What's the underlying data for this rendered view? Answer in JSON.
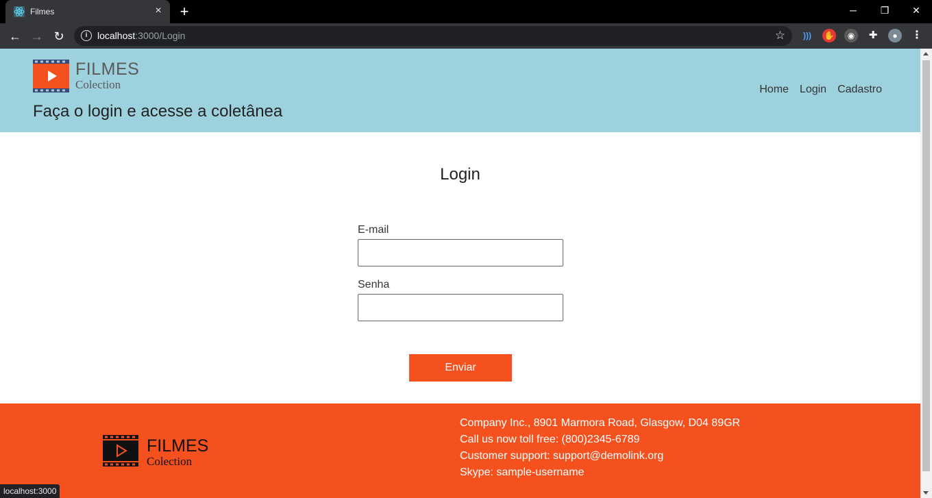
{
  "browser": {
    "tab_title": "Filmes",
    "tab_close": "×",
    "new_tab": "+",
    "url_host": "localhost",
    "url_path": ":3000/Login",
    "status_url": "localhost:3000",
    "window_controls": {
      "minimize": "─",
      "restore": "❐",
      "close": "✕"
    },
    "nav": {
      "back": "←",
      "forward": "→",
      "reload": "↻"
    }
  },
  "header": {
    "logo_title": "FILMES",
    "logo_subtitle": "Colection",
    "subtitle": "Faça o login e acesse a coletânea",
    "nav": [
      {
        "label": "Home"
      },
      {
        "label": "Login"
      },
      {
        "label": "Cadastro"
      }
    ],
    "background": "#9dd1de"
  },
  "main": {
    "title": "Login",
    "email_label": "E-mail",
    "email_value": "",
    "password_label": "Senha",
    "password_value": "",
    "submit_label": "Enviar"
  },
  "footer": {
    "logo_title": "FILMES",
    "logo_subtitle": "Colection",
    "contact": [
      "Company Inc., 8901 Marmora Road, Glasgow, D04 89GR",
      "Call us now toll free: (800)2345-6789",
      "Customer support: support@demolink.org",
      "Skype: sample-username"
    ],
    "background": "#f4511e"
  },
  "icons": {
    "favicon": "react-icon",
    "info": "info-icon",
    "star": "bookmark-star-icon",
    "extensions": [
      "audio-extension-icon",
      "stop-hand-extension-icon",
      "spy-extension-icon",
      "puzzle-extensions-icon",
      "profile-avatar-icon",
      "kebab-menu-icon"
    ]
  }
}
